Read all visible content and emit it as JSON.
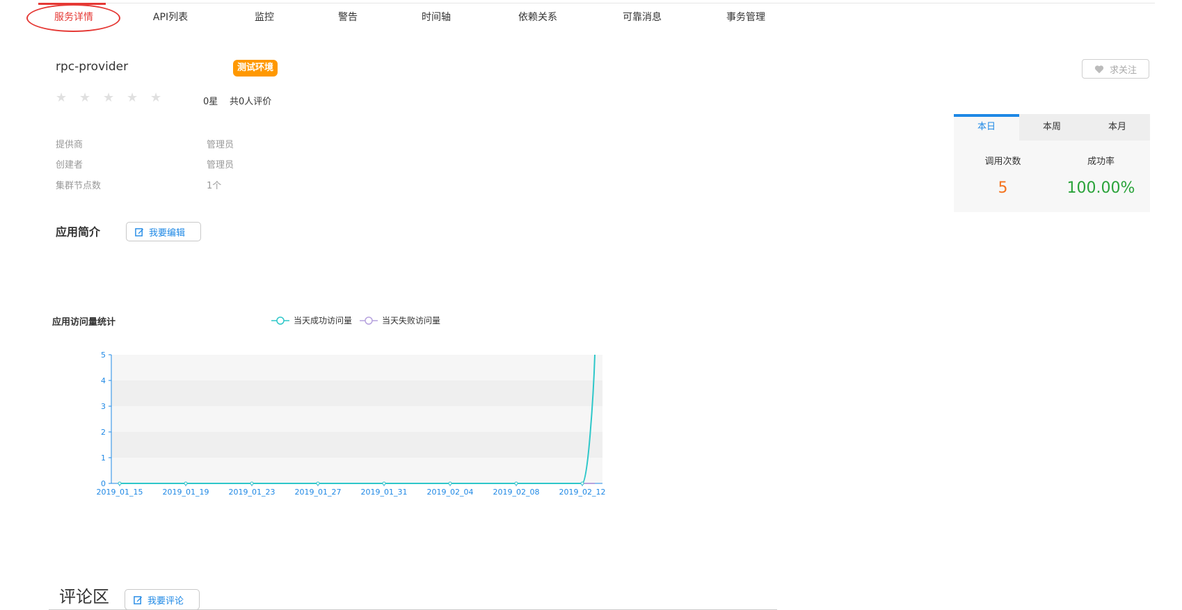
{
  "nav": {
    "tabs": [
      {
        "label": "服务详情",
        "active": true
      },
      {
        "label": "API列表"
      },
      {
        "label": "监控"
      },
      {
        "label": "警告"
      },
      {
        "label": "时间轴"
      },
      {
        "label": "依赖关系"
      },
      {
        "label": "可靠消息"
      },
      {
        "label": "事务管理"
      }
    ]
  },
  "service": {
    "name": "rpc-provider",
    "env_badge": "测试环境",
    "rating": 0,
    "rating_max": 5,
    "star_count_text": "0星",
    "review_text": "共0人评价",
    "follow_label": "求关注"
  },
  "info": [
    {
      "label": "提供商",
      "value": "管理员"
    },
    {
      "label": "创建者",
      "value": "管理员"
    },
    {
      "label": "集群节点数",
      "value": "1个"
    }
  ],
  "intro": {
    "title": "应用简介",
    "edit_label": "我要编辑"
  },
  "stats": {
    "tabs": [
      "本日",
      "本周",
      "本月"
    ],
    "active_tab": 0,
    "calls_label": "调用次数",
    "calls_value": "5",
    "success_label": "成功率",
    "success_value": "100.00%",
    "calls_color": "#f4731f",
    "success_color": "#2aa33a"
  },
  "chart_title": "应用访问量统计",
  "chart_data": {
    "type": "line",
    "title": "应用访问量统计",
    "x": [
      "2019_01_15",
      "2019_01_19",
      "2019_01_23",
      "2019_01_27",
      "2019_01_31",
      "2019_02_04",
      "2019_02_08",
      "2019_02_12",
      "2019_02_13"
    ],
    "x_tick_labels": [
      "2019_01_15",
      "2019_01_19",
      "2019_01_23",
      "2019_01_27",
      "2019_01_31",
      "2019_02_04",
      "2019_02_08",
      "2019_02_12"
    ],
    "series": [
      {
        "name": "当天成功访问量",
        "color": "#2ec7c9",
        "values": [
          0,
          0,
          0,
          0,
          0,
          0,
          0,
          0,
          5
        ]
      },
      {
        "name": "当天失败访问量",
        "color": "#b6a2de",
        "values": [
          0,
          0,
          0,
          0,
          0,
          0,
          0,
          0,
          0
        ]
      }
    ],
    "ylim": [
      0,
      5
    ],
    "yticks": [
      0,
      1,
      2,
      3,
      4,
      5
    ],
    "legend": "top",
    "grid": true
  },
  "comments": {
    "title": "评论区",
    "comment_label": "我要评论"
  },
  "colors": {
    "accent": "#1e88e5",
    "active_nav": "#e53935",
    "badge": "#ff9800"
  }
}
